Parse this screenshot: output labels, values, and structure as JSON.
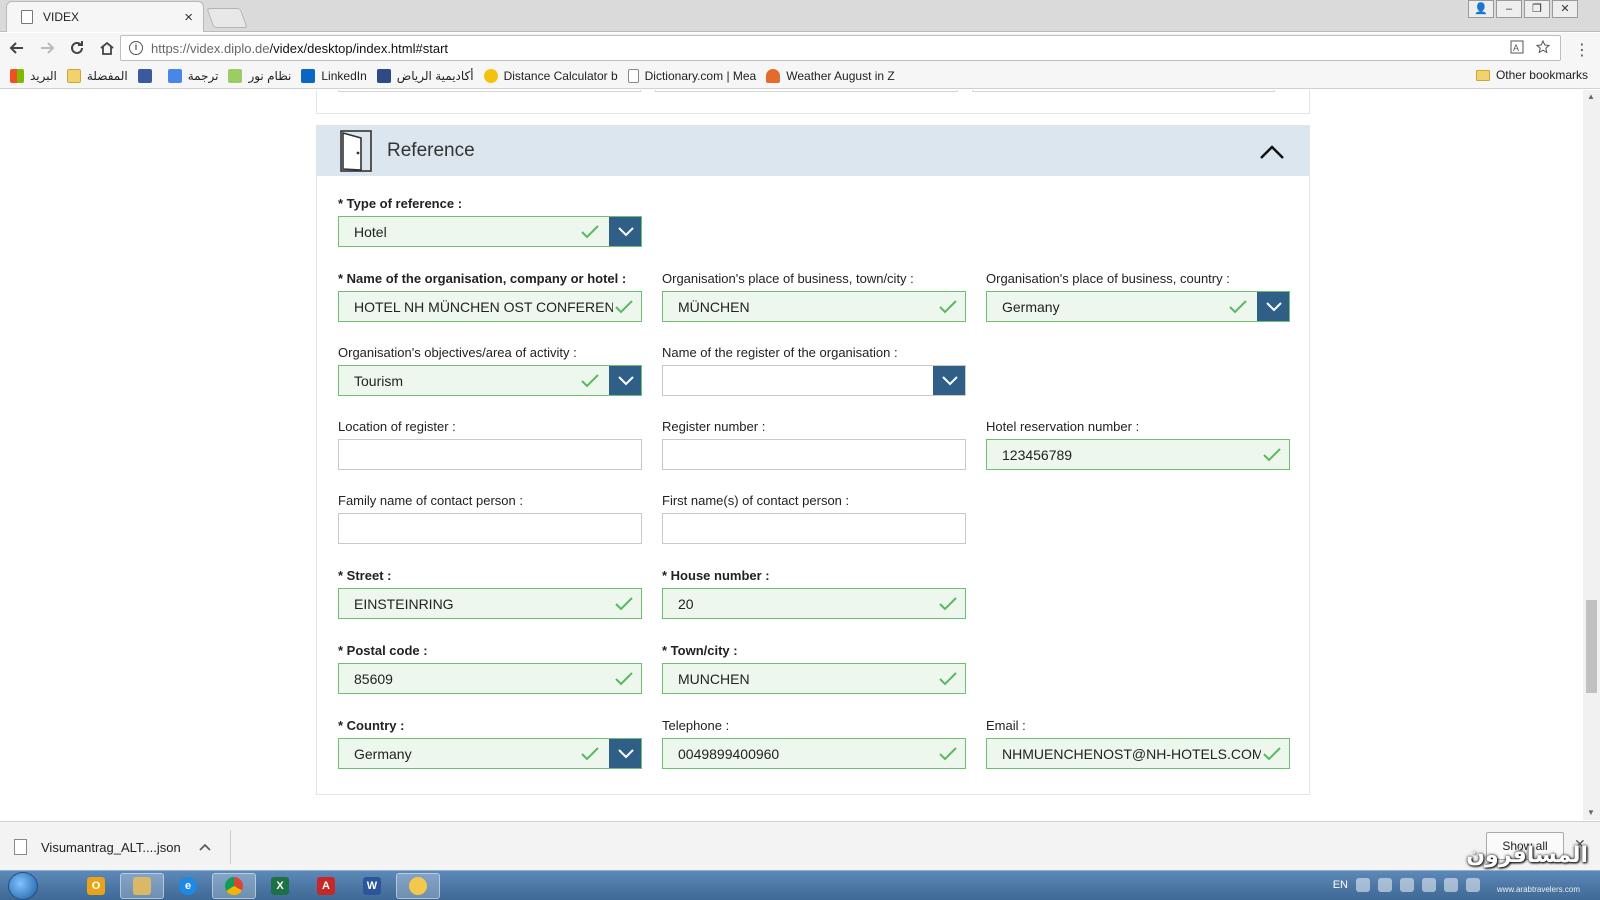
{
  "browser": {
    "tab_title": "VIDEX",
    "tab_close": "×",
    "url_host": "https://videx.diplo.de",
    "url_path": "/videx/desktop/index.html#start",
    "window_controls": [
      "👤",
      "–",
      "❐",
      "✕"
    ]
  },
  "bookmarks": [
    {
      "label": "البريد",
      "color": "#e8463a"
    },
    {
      "label": "المفضلة",
      "color": "#f2d36b"
    },
    {
      "label": "",
      "color": "#3a5a9c"
    },
    {
      "label": "ترجمة",
      "color": "#4a86e8"
    },
    {
      "label": "نظام نور",
      "color": "#9ccc65"
    },
    {
      "label": "LinkedIn",
      "color": "#0a66c2"
    },
    {
      "label": "أكاديمية الرياض",
      "color": "#2c4a86"
    },
    {
      "label": "Distance Calculator b",
      "color": "#f4c20d"
    },
    {
      "label": "Dictionary.com | Mea",
      "color": "#ffffff"
    },
    {
      "label": "Weather August in Z",
      "color": "#e36c2c"
    }
  ],
  "other_bookmarks": "Other bookmarks",
  "section": {
    "title": "Reference"
  },
  "fields": {
    "type_of_reference": {
      "label": "* Type of reference :",
      "value": "Hotel"
    },
    "org_name": {
      "label": "* Name of the organisation, company or hotel :",
      "value": "HOTEL NH MÜNCHEN OST CONFEREN"
    },
    "org_town": {
      "label": "Organisation's place of business, town/city :",
      "value": "MÜNCHEN"
    },
    "org_country": {
      "label": "Organisation's place of business, country :",
      "value": "Germany"
    },
    "org_objectives": {
      "label": "Organisation's objectives/area of activity :",
      "value": "Tourism"
    },
    "register_name": {
      "label": "Name of the register of the organisation :",
      "value": ""
    },
    "register_location": {
      "label": "Location of register :",
      "value": ""
    },
    "register_number": {
      "label": "Register number :",
      "value": ""
    },
    "hotel_reservation": {
      "label": "Hotel reservation number :",
      "value": "123456789"
    },
    "contact_family": {
      "label": "Family name of contact person :",
      "value": ""
    },
    "contact_first": {
      "label": "First name(s) of contact person :",
      "value": ""
    },
    "street": {
      "label": "* Street :",
      "value": "EINSTEINRING"
    },
    "house_number": {
      "label": "* House number :",
      "value": "20"
    },
    "postal_code": {
      "label": "* Postal code :",
      "value": "85609"
    },
    "town": {
      "label": "* Town/city :",
      "value": "MUNCHEN"
    },
    "country": {
      "label": "* Country :",
      "value": "Germany"
    },
    "telephone": {
      "label": "Telephone :",
      "value": "0049899400960"
    },
    "email": {
      "label": "Email :",
      "value": "NHMUENCHENOST@NH-HOTELS.COM"
    }
  },
  "download": {
    "filename": "Visumantrag_ALT....json",
    "show_all": "Show all",
    "close": "✕"
  },
  "taskbar": {
    "lang": "EN"
  },
  "watermark": {
    "main": "المسافرون",
    "sub": "www.arabtravelers.com"
  },
  "colors": {
    "valid_bg": "#edf7ed",
    "valid_border": "#6fbf73",
    "check": "#5cb860",
    "dropdown": "#2f5f86",
    "section_header": "#dbe6ef"
  }
}
